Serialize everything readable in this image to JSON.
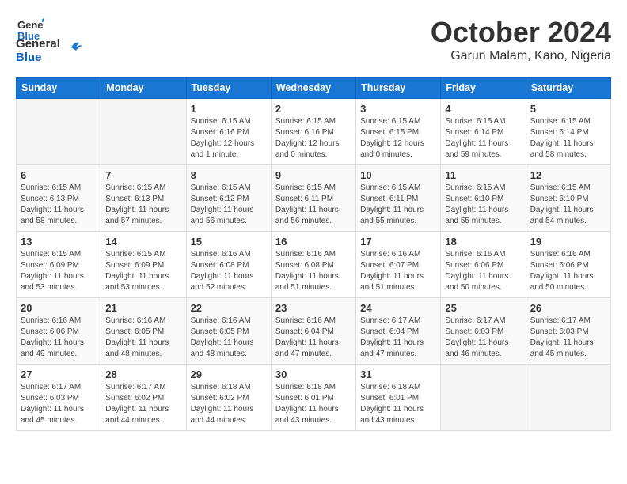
{
  "header": {
    "logo_line1": "General",
    "logo_line2": "Blue",
    "title": "October 2024",
    "subtitle": "Garun Malam, Kano, Nigeria"
  },
  "weekdays": [
    "Sunday",
    "Monday",
    "Tuesday",
    "Wednesday",
    "Thursday",
    "Friday",
    "Saturday"
  ],
  "weeks": [
    [
      {
        "day": "",
        "info": ""
      },
      {
        "day": "",
        "info": ""
      },
      {
        "day": "1",
        "info": "Sunrise: 6:15 AM\nSunset: 6:16 PM\nDaylight: 12 hours\nand 1 minute."
      },
      {
        "day": "2",
        "info": "Sunrise: 6:15 AM\nSunset: 6:16 PM\nDaylight: 12 hours\nand 0 minutes."
      },
      {
        "day": "3",
        "info": "Sunrise: 6:15 AM\nSunset: 6:15 PM\nDaylight: 12 hours\nand 0 minutes."
      },
      {
        "day": "4",
        "info": "Sunrise: 6:15 AM\nSunset: 6:14 PM\nDaylight: 11 hours\nand 59 minutes."
      },
      {
        "day": "5",
        "info": "Sunrise: 6:15 AM\nSunset: 6:14 PM\nDaylight: 11 hours\nand 58 minutes."
      }
    ],
    [
      {
        "day": "6",
        "info": "Sunrise: 6:15 AM\nSunset: 6:13 PM\nDaylight: 11 hours\nand 58 minutes."
      },
      {
        "day": "7",
        "info": "Sunrise: 6:15 AM\nSunset: 6:13 PM\nDaylight: 11 hours\nand 57 minutes."
      },
      {
        "day": "8",
        "info": "Sunrise: 6:15 AM\nSunset: 6:12 PM\nDaylight: 11 hours\nand 56 minutes."
      },
      {
        "day": "9",
        "info": "Sunrise: 6:15 AM\nSunset: 6:11 PM\nDaylight: 11 hours\nand 56 minutes."
      },
      {
        "day": "10",
        "info": "Sunrise: 6:15 AM\nSunset: 6:11 PM\nDaylight: 11 hours\nand 55 minutes."
      },
      {
        "day": "11",
        "info": "Sunrise: 6:15 AM\nSunset: 6:10 PM\nDaylight: 11 hours\nand 55 minutes."
      },
      {
        "day": "12",
        "info": "Sunrise: 6:15 AM\nSunset: 6:10 PM\nDaylight: 11 hours\nand 54 minutes."
      }
    ],
    [
      {
        "day": "13",
        "info": "Sunrise: 6:15 AM\nSunset: 6:09 PM\nDaylight: 11 hours\nand 53 minutes."
      },
      {
        "day": "14",
        "info": "Sunrise: 6:15 AM\nSunset: 6:09 PM\nDaylight: 11 hours\nand 53 minutes."
      },
      {
        "day": "15",
        "info": "Sunrise: 6:16 AM\nSunset: 6:08 PM\nDaylight: 11 hours\nand 52 minutes."
      },
      {
        "day": "16",
        "info": "Sunrise: 6:16 AM\nSunset: 6:08 PM\nDaylight: 11 hours\nand 51 minutes."
      },
      {
        "day": "17",
        "info": "Sunrise: 6:16 AM\nSunset: 6:07 PM\nDaylight: 11 hours\nand 51 minutes."
      },
      {
        "day": "18",
        "info": "Sunrise: 6:16 AM\nSunset: 6:06 PM\nDaylight: 11 hours\nand 50 minutes."
      },
      {
        "day": "19",
        "info": "Sunrise: 6:16 AM\nSunset: 6:06 PM\nDaylight: 11 hours\nand 50 minutes."
      }
    ],
    [
      {
        "day": "20",
        "info": "Sunrise: 6:16 AM\nSunset: 6:06 PM\nDaylight: 11 hours\nand 49 minutes."
      },
      {
        "day": "21",
        "info": "Sunrise: 6:16 AM\nSunset: 6:05 PM\nDaylight: 11 hours\nand 48 minutes."
      },
      {
        "day": "22",
        "info": "Sunrise: 6:16 AM\nSunset: 6:05 PM\nDaylight: 11 hours\nand 48 minutes."
      },
      {
        "day": "23",
        "info": "Sunrise: 6:16 AM\nSunset: 6:04 PM\nDaylight: 11 hours\nand 47 minutes."
      },
      {
        "day": "24",
        "info": "Sunrise: 6:17 AM\nSunset: 6:04 PM\nDaylight: 11 hours\nand 47 minutes."
      },
      {
        "day": "25",
        "info": "Sunrise: 6:17 AM\nSunset: 6:03 PM\nDaylight: 11 hours\nand 46 minutes."
      },
      {
        "day": "26",
        "info": "Sunrise: 6:17 AM\nSunset: 6:03 PM\nDaylight: 11 hours\nand 45 minutes."
      }
    ],
    [
      {
        "day": "27",
        "info": "Sunrise: 6:17 AM\nSunset: 6:03 PM\nDaylight: 11 hours\nand 45 minutes."
      },
      {
        "day": "28",
        "info": "Sunrise: 6:17 AM\nSunset: 6:02 PM\nDaylight: 11 hours\nand 44 minutes."
      },
      {
        "day": "29",
        "info": "Sunrise: 6:18 AM\nSunset: 6:02 PM\nDaylight: 11 hours\nand 44 minutes."
      },
      {
        "day": "30",
        "info": "Sunrise: 6:18 AM\nSunset: 6:01 PM\nDaylight: 11 hours\nand 43 minutes."
      },
      {
        "day": "31",
        "info": "Sunrise: 6:18 AM\nSunset: 6:01 PM\nDaylight: 11 hours\nand 43 minutes."
      },
      {
        "day": "",
        "info": ""
      },
      {
        "day": "",
        "info": ""
      }
    ]
  ]
}
